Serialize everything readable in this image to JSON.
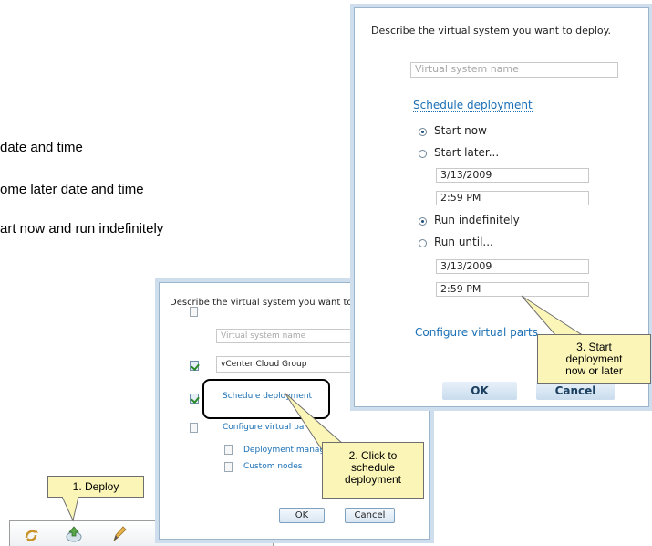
{
  "bullets": [
    "date and time",
    "ome later date and time",
    "art now and run indefinitely"
  ],
  "toolbar": {
    "deploy_icon": "deploy-icon",
    "refresh_icon": "refresh-icon",
    "edit_icon": "pencil-icon"
  },
  "small_dialog": {
    "prompt": "Describe the virtual system you want to de",
    "name_placeholder": "Virtual system name",
    "cloud_group": "vCenter Cloud Group",
    "schedule_link": "Schedule deployment",
    "configure_link": "Configure virtual par",
    "deployment_link": "Deployment manag",
    "custom_nodes_link": "Custom nodes",
    "ok_label": "OK",
    "cancel_label": "Cancel"
  },
  "large_dialog": {
    "prompt": "Describe the virtual system you want to deploy.",
    "name_placeholder": "Virtual system name",
    "schedule_link": "Schedule deployment",
    "start_now": "Start now",
    "start_later": "Start later...",
    "start_date": "3/13/2009",
    "start_time": "2:59 PM",
    "run_indefinitely": "Run indefinitely",
    "run_until": "Run until...",
    "end_date": "3/13/2009",
    "end_time": "2:59 PM",
    "configure_link": "Configure virtual parts",
    "ok_label": "OK",
    "cancel_label": "Cancel",
    "start_now_selected": true,
    "run_indefinitely_selected": true
  },
  "callouts": {
    "deploy": "1. Deploy",
    "schedule": [
      "2. Click to",
      "schedule",
      "deployment"
    ],
    "start": [
      "3. Start",
      "deployment",
      "now or later"
    ]
  },
  "colors": {
    "link": "#1a6fb5",
    "callout_bg": "#fbf6b8",
    "dialog_border": "#9bb5cc"
  }
}
